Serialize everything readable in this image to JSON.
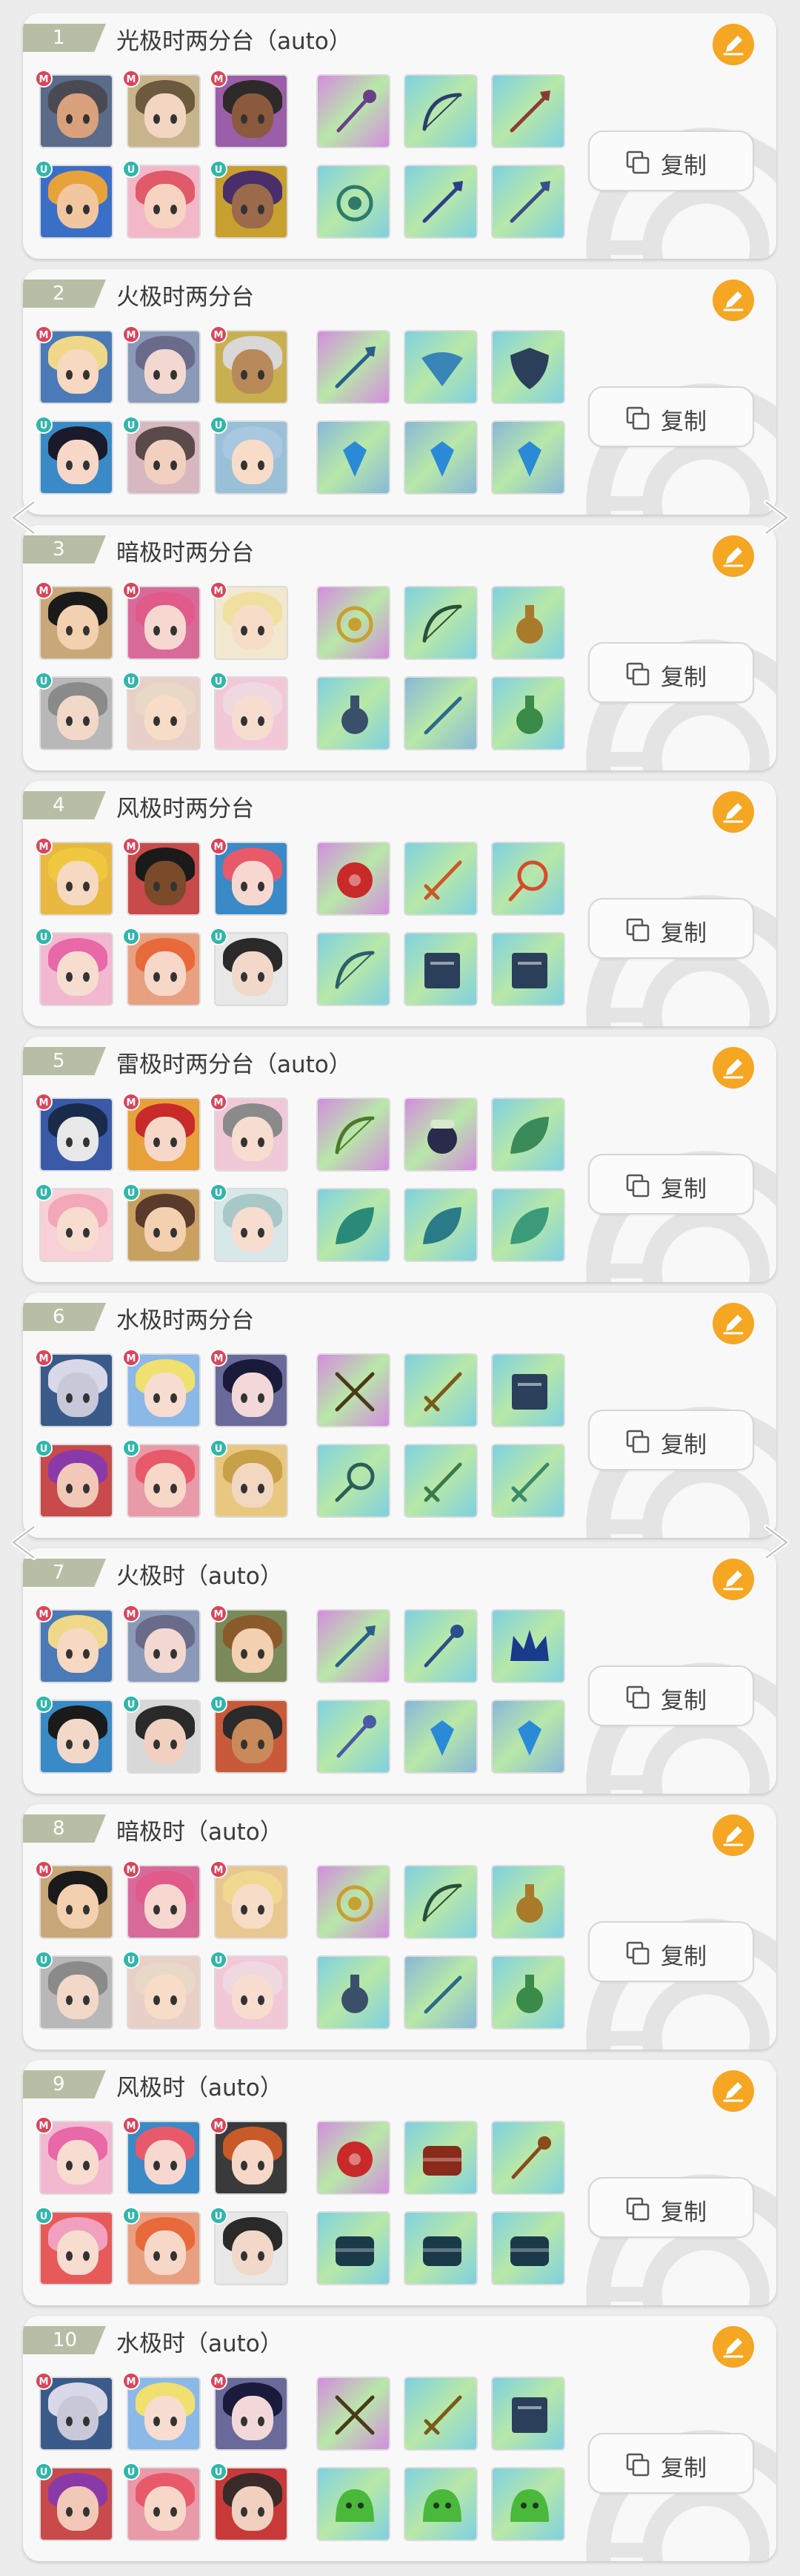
{
  "colors": {
    "accent_orange": "#f5a623",
    "badge_m": "#d9455b",
    "badge_u": "#2fb7ac",
    "tab_bg": "#b6bfa6"
  },
  "labels": {
    "copy": "复制",
    "badge_m": "M",
    "badge_u": "U"
  },
  "icons": {
    "edit": "pencil-icon",
    "copy": "copy-icon",
    "prev": "chevron-left-icon",
    "next": "chevron-right-icon"
  },
  "teams": [
    {
      "number": "1",
      "title": "光极时两分台（auto）",
      "main": [
        {
          "hair": "#4a4a52",
          "skin": "#d9a27c",
          "bg": "#5b6b8a"
        },
        {
          "hair": "#6b5a3e",
          "skin": "#f2d6c2",
          "bg": "#c8b48c"
        },
        {
          "hair": "#2e2a2a",
          "skin": "#8b5a3c",
          "bg": "#9a5fa8"
        }
      ],
      "main_items": [
        {
          "bg": "#d48ce0",
          "icon": "staff-icon",
          "fg": "#6a3f8a"
        },
        {
          "bg": "#7fd0e0",
          "icon": "bow-icon",
          "fg": "#2b3f6b"
        },
        {
          "bg": "#7fd0e0",
          "icon": "spear-icon",
          "fg": "#8b3a3a"
        }
      ],
      "unison": [
        {
          "hair": "#e8a23c",
          "skin": "#f2c7a0",
          "bg": "#3a6fc8"
        },
        {
          "hair": "#e05a6a",
          "skin": "#f7d3c2",
          "bg": "#f2b8c8"
        },
        {
          "hair": "#4a2e6a",
          "skin": "#9a6a4a",
          "bg": "#c8a030"
        }
      ],
      "unison_items": [
        {
          "bg": "#7fd0e0",
          "icon": "orb-icon",
          "fg": "#2f7a6a"
        },
        {
          "bg": "#7fd0e0",
          "icon": "spear-icon",
          "fg": "#2b3f8a"
        },
        {
          "bg": "#7fd0e0",
          "icon": "spear-icon",
          "fg": "#3a4f8a"
        }
      ]
    },
    {
      "number": "2",
      "title": "火极时两分台",
      "main": [
        {
          "hair": "#f0d88a",
          "skin": "#f7d8c0",
          "bg": "#4a7ab8"
        },
        {
          "hair": "#6a6a8a",
          "skin": "#f2d8d0",
          "bg": "#8a9ab8"
        },
        {
          "hair": "#d8d8d8",
          "skin": "#b88a5a",
          "bg": "#c8b050"
        }
      ],
      "main_items": [
        {
          "bg": "#d48ce0",
          "icon": "spear-icon",
          "fg": "#2b5f8a"
        },
        {
          "bg": "#7fd0e0",
          "icon": "fan-icon",
          "fg": "#2b7ab8"
        },
        {
          "bg": "#7fd0e0",
          "icon": "shield-icon",
          "fg": "#2b3f5a"
        }
      ],
      "unison": [
        {
          "hair": "#1a1a2a",
          "skin": "#f7d8c8",
          "bg": "#3a8ac8"
        },
        {
          "hair": "#5a4a4a",
          "skin": "#f2d0c0",
          "bg": "#d8b8c0"
        },
        {
          "hair": "#a8c8e0",
          "skin": "#f7dcc8",
          "bg": "#9ac0d8"
        }
      ],
      "unison_items": [
        {
          "bg": "#88b8d8",
          "icon": "gem-icon",
          "fg": "#2b8ad8"
        },
        {
          "bg": "#88b8d8",
          "icon": "gem-icon",
          "fg": "#2b8ad8"
        },
        {
          "bg": "#88b8d8",
          "icon": "gem-icon",
          "fg": "#2b8ad8"
        }
      ]
    },
    {
      "number": "3",
      "title": "暗极时两分台",
      "main": [
        {
          "hair": "#1a1a1a",
          "skin": "#f2d0b0",
          "bg": "#c8a878"
        },
        {
          "hair": "#e05a8a",
          "skin": "#f7d8d0",
          "bg": "#d86a9a"
        },
        {
          "hair": "#f0e0a0",
          "skin": "#f7dcc8",
          "bg": "#f2e8d0"
        }
      ],
      "main_items": [
        {
          "bg": "#d48ce0",
          "icon": "orb-icon",
          "fg": "#c8a030"
        },
        {
          "bg": "#7fd0e0",
          "icon": "bow-icon",
          "fg": "#2b4f3a"
        },
        {
          "bg": "#7fd0e0",
          "icon": "bottle-icon",
          "fg": "#a87a2a"
        }
      ],
      "unison": [
        {
          "hair": "#8a8a8a",
          "skin": "#f2d8c8",
          "bg": "#b8b8b8"
        },
        {
          "hair": "#e8d8c8",
          "skin": "#f7dcc8",
          "bg": "#e8d0c8"
        },
        {
          "hair": "#f0d8e0",
          "skin": "#f7dcd0",
          "bg": "#f2c8d8"
        }
      ],
      "unison_items": [
        {
          "bg": "#7fd0e0",
          "icon": "bottle-icon",
          "fg": "#3a4f6a"
        },
        {
          "bg": "#88b8d8",
          "icon": "needle-icon",
          "fg": "#2b6a8a"
        },
        {
          "bg": "#7fd0e0",
          "icon": "bottle-icon",
          "fg": "#3a8a4a"
        }
      ]
    },
    {
      "number": "4",
      "title": "风极时两分台",
      "main": [
        {
          "hair": "#f0c840",
          "skin": "#f7d8c0",
          "bg": "#e8b840"
        },
        {
          "hair": "#1a1a1a",
          "skin": "#7a4a2a",
          "bg": "#c84a4a"
        },
        {
          "hair": "#e85a6a",
          "skin": "#f7d8d0",
          "bg": "#3a8ac8"
        }
      ],
      "main_items": [
        {
          "bg": "#d48ce0",
          "icon": "flower-icon",
          "fg": "#c82a2a"
        },
        {
          "bg": "#7fd0e0",
          "icon": "sword-icon",
          "fg": "#c85a2a"
        },
        {
          "bg": "#7fd0e0",
          "icon": "ring-icon",
          "fg": "#d84a2a"
        }
      ],
      "unison": [
        {
          "hair": "#e868a8",
          "skin": "#f7dcd0",
          "bg": "#f2b8d0"
        },
        {
          "hair": "#e86a3a",
          "skin": "#f7d8c8",
          "bg": "#e8a080"
        },
        {
          "hair": "#2a2a2a",
          "skin": "#f2d8c8",
          "bg": "#e8e8e8"
        }
      ],
      "unison_items": [
        {
          "bg": "#7fd0e0",
          "icon": "bow-icon",
          "fg": "#2b5f6a"
        },
        {
          "bg": "#7fd0e0",
          "icon": "book-icon",
          "fg": "#2b3f5a"
        },
        {
          "bg": "#7fd0e0",
          "icon": "book-icon",
          "fg": "#2b3f5a"
        }
      ]
    },
    {
      "number": "5",
      "title": "雷极时两分台（auto）",
      "main": [
        {
          "hair": "#1a2a4a",
          "skin": "#e8e8e8",
          "bg": "#3a5aa8"
        },
        {
          "hair": "#c82a2a",
          "skin": "#f7d8c8",
          "bg": "#e8a03a"
        },
        {
          "hair": "#8a8a8a",
          "skin": "#f7dcd0",
          "bg": "#f0c8d8"
        }
      ],
      "main_items": [
        {
          "bg": "#d48ce0",
          "icon": "bow-icon",
          "fg": "#4a7a2a"
        },
        {
          "bg": "#d48ce0",
          "icon": "bell-icon",
          "fg": "#2a2a4a"
        },
        {
          "bg": "#7fd0e0",
          "icon": "leaf-icon",
          "fg": "#3a8a5a"
        }
      ],
      "unison": [
        {
          "hair": "#f2a8b8",
          "skin": "#f7dcd0",
          "bg": "#f8d0d8"
        },
        {
          "hair": "#5a3a2a",
          "skin": "#f2d0b0",
          "bg": "#c8a060"
        },
        {
          "hair": "#a8c8c8",
          "skin": "#f7dcd0",
          "bg": "#d8e8e8"
        }
      ],
      "unison_items": [
        {
          "bg": "#7fd0e0",
          "icon": "leaf-icon",
          "fg": "#2a8a7a"
        },
        {
          "bg": "#7fd0e0",
          "icon": "leaf-icon",
          "fg": "#2a7a8a"
        },
        {
          "bg": "#7fd0e0",
          "icon": "leaf-icon",
          "fg": "#3a9a7a"
        }
      ]
    },
    {
      "number": "6",
      "title": "水极时两分台",
      "main": [
        {
          "hair": "#d8d8e8",
          "skin": "#c8c8d8",
          "bg": "#3a5a8a"
        },
        {
          "hair": "#f0e070",
          "skin": "#f7dcd0",
          "bg": "#8ab8e8"
        },
        {
          "hair": "#1a1a3a",
          "skin": "#f2d8d8",
          "bg": "#6a6a9a"
        }
      ],
      "main_items": [
        {
          "bg": "#d48ce0",
          "icon": "crossbow-icon",
          "fg": "#4a3a1a"
        },
        {
          "bg": "#7fd0e0",
          "icon": "sword-icon",
          "fg": "#7a5a1a"
        },
        {
          "bg": "#7fd0e0",
          "icon": "book-icon",
          "fg": "#2b3f5a"
        }
      ],
      "unison": [
        {
          "hair": "#8a3aa8",
          "skin": "#f2c8b8",
          "bg": "#c84a4a"
        },
        {
          "hair": "#e85a6a",
          "skin": "#f7d8c8",
          "bg": "#e89aa8"
        },
        {
          "hair": "#c8a04a",
          "skin": "#f2d8c0",
          "bg": "#e8c880"
        }
      ],
      "unison_items": [
        {
          "bg": "#7fd0e0",
          "icon": "racket-icon",
          "fg": "#2b5f5a"
        },
        {
          "bg": "#7fd0e0",
          "icon": "sword-icon",
          "fg": "#3a7a4a"
        },
        {
          "bg": "#7fd0e0",
          "icon": "sword-icon",
          "fg": "#3a8a6a"
        }
      ]
    },
    {
      "number": "7",
      "title": "火极时（auto）",
      "main": [
        {
          "hair": "#f0d88a",
          "skin": "#f7d8c0",
          "bg": "#4a7ab8"
        },
        {
          "hair": "#6a6a8a",
          "skin": "#f2d8d0",
          "bg": "#8a9ab8"
        },
        {
          "hair": "#8a5a2a",
          "skin": "#f2d0b0",
          "bg": "#7a8a5a"
        }
      ],
      "main_items": [
        {
          "bg": "#d48ce0",
          "icon": "spear-icon",
          "fg": "#2b5f8a"
        },
        {
          "bg": "#7fd0e0",
          "icon": "staff-icon",
          "fg": "#2b4f8a"
        },
        {
          "bg": "#7fd0e0",
          "icon": "crown-icon",
          "fg": "#1a3a8a"
        }
      ],
      "unison": [
        {
          "hair": "#1a1a1a",
          "skin": "#f2d8c8",
          "bg": "#3a8ac8"
        },
        {
          "hair": "#2a2a2a",
          "skin": "#f2d0c0",
          "bg": "#d8d8d8"
        },
        {
          "hair": "#2a2a2a",
          "skin": "#c88a5a",
          "bg": "#c85a3a"
        }
      ],
      "unison_items": [
        {
          "bg": "#7fd0e0",
          "icon": "staff-icon",
          "fg": "#4a5aa8"
        },
        {
          "bg": "#88b8d8",
          "icon": "gem-icon",
          "fg": "#2b8ad8"
        },
        {
          "bg": "#88b8d8",
          "icon": "gem-icon",
          "fg": "#2b8ad8"
        }
      ]
    },
    {
      "number": "8",
      "title": "暗极时（auto）",
      "main": [
        {
          "hair": "#1a1a1a",
          "skin": "#f2d0b0",
          "bg": "#c8a878"
        },
        {
          "hair": "#e05a8a",
          "skin": "#f7d8d0",
          "bg": "#d86a9a"
        },
        {
          "hair": "#f0d890",
          "skin": "#f7dcc8",
          "bg": "#e8c890"
        }
      ],
      "main_items": [
        {
          "bg": "#d48ce0",
          "icon": "orb-icon",
          "fg": "#c8a030"
        },
        {
          "bg": "#7fd0e0",
          "icon": "bow-icon",
          "fg": "#2b4f3a"
        },
        {
          "bg": "#7fd0e0",
          "icon": "bottle-icon",
          "fg": "#a87a2a"
        }
      ],
      "unison": [
        {
          "hair": "#8a8a8a",
          "skin": "#f2d8c8",
          "bg": "#b8b8b8"
        },
        {
          "hair": "#e8d8c8",
          "skin": "#f7dcc8",
          "bg": "#e8d0c8"
        },
        {
          "hair": "#f0d8e0",
          "skin": "#f7dcd0",
          "bg": "#f2c8d8"
        }
      ],
      "unison_items": [
        {
          "bg": "#7fd0e0",
          "icon": "bottle-icon",
          "fg": "#3a4f6a"
        },
        {
          "bg": "#88b8d8",
          "icon": "needle-icon",
          "fg": "#2b6a8a"
        },
        {
          "bg": "#7fd0e0",
          "icon": "bottle-icon",
          "fg": "#3a8a4a"
        }
      ]
    },
    {
      "number": "9",
      "title": "风极时（auto）",
      "main": [
        {
          "hair": "#e868a8",
          "skin": "#f7dcd0",
          "bg": "#f2b8d0"
        },
        {
          "hair": "#e85a6a",
          "skin": "#f7d8d0",
          "bg": "#3a8ac8"
        },
        {
          "hair": "#c85a2a",
          "skin": "#f7d8c8",
          "bg": "#3a3a3a"
        }
      ],
      "main_items": [
        {
          "bg": "#d48ce0",
          "icon": "flower-icon",
          "fg": "#c82a2a"
        },
        {
          "bg": "#7fd0e0",
          "icon": "chest-icon",
          "fg": "#8a2a1a"
        },
        {
          "bg": "#7fd0e0",
          "icon": "staff-icon",
          "fg": "#8a4a1a"
        }
      ],
      "unison": [
        {
          "hair": "#f2a0c0",
          "skin": "#f7dcd0",
          "bg": "#e85a5a"
        },
        {
          "hair": "#e86a3a",
          "skin": "#f7d8c8",
          "bg": "#e8a080"
        },
        {
          "hair": "#2a2a2a",
          "skin": "#f2d8c8",
          "bg": "#e8e8e8"
        }
      ],
      "unison_items": [
        {
          "bg": "#7fd0e0",
          "icon": "chest-icon",
          "fg": "#1a3a4a"
        },
        {
          "bg": "#7fd0e0",
          "icon": "chest-icon",
          "fg": "#1a3a4a"
        },
        {
          "bg": "#7fd0e0",
          "icon": "chest-icon",
          "fg": "#1a3a4a"
        }
      ]
    },
    {
      "number": "10",
      "title": "水极时（auto）",
      "main": [
        {
          "hair": "#d8d8e8",
          "skin": "#c8c8d8",
          "bg": "#3a5a8a"
        },
        {
          "hair": "#f0e070",
          "skin": "#f7dcd0",
          "bg": "#8ab8e8"
        },
        {
          "hair": "#1a1a3a",
          "skin": "#f2d8d8",
          "bg": "#6a6a9a"
        }
      ],
      "main_items": [
        {
          "bg": "#d48ce0",
          "icon": "crossbow-icon",
          "fg": "#4a3a1a"
        },
        {
          "bg": "#7fd0e0",
          "icon": "sword-icon",
          "fg": "#7a5a1a"
        },
        {
          "bg": "#7fd0e0",
          "icon": "book-icon",
          "fg": "#2b3f5a"
        }
      ],
      "unison": [
        {
          "hair": "#8a3aa8",
          "skin": "#f2c8b8",
          "bg": "#c84a4a"
        },
        {
          "hair": "#e85a6a",
          "skin": "#f7d8c8",
          "bg": "#e89aa8"
        },
        {
          "hair": "#3a2a2a",
          "skin": "#f2d0c0",
          "bg": "#c83a3a"
        }
      ],
      "unison_items": [
        {
          "bg": "#7fd0e0",
          "icon": "slime-icon",
          "fg": "#4ab83a"
        },
        {
          "bg": "#7fd0e0",
          "icon": "slime-icon",
          "fg": "#4ab83a"
        },
        {
          "bg": "#7fd0e0",
          "icon": "slime-icon",
          "fg": "#4ab83a"
        }
      ]
    }
  ]
}
